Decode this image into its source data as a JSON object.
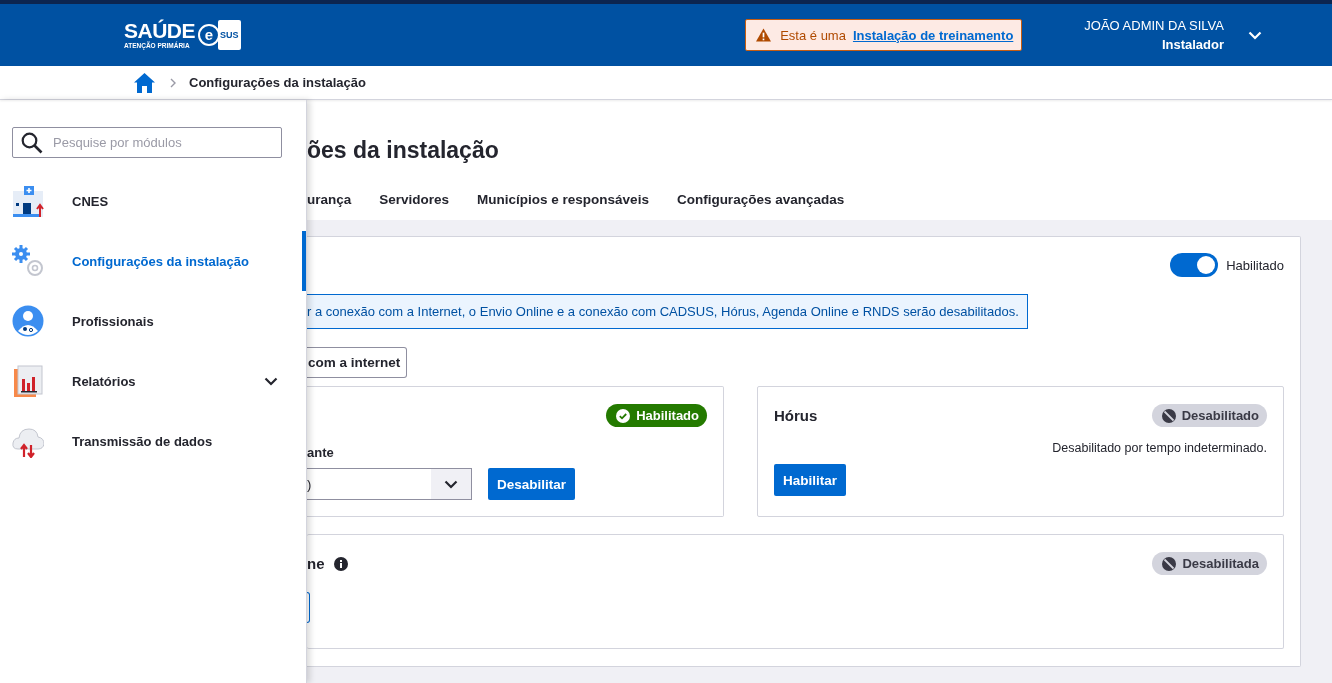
{
  "header": {
    "logo": {
      "title": "SAÚDE",
      "subtitle": "ATENÇÃO PRIMÁRIA",
      "mark": "e",
      "mark_text": "SUS"
    },
    "training_notice": {
      "prefix": "Esta é uma",
      "link": "Instalação de treinamento"
    },
    "user": {
      "name": "JOÃO ADMIN DA SILVA",
      "role": "Instalador"
    }
  },
  "breadcrumb": {
    "current": "Configurações da instalação"
  },
  "drawer": {
    "search": {
      "placeholder": "Pesquise por módulos"
    },
    "items": [
      {
        "label": "CNES",
        "kind": "building",
        "selected": false,
        "has_submenu": false
      },
      {
        "label": "Configurações da instalação",
        "kind": "gears",
        "selected": true,
        "has_submenu": false
      },
      {
        "label": "Profissionais",
        "kind": "person",
        "selected": false,
        "has_submenu": false
      },
      {
        "label": "Relatórios",
        "kind": "report",
        "selected": false,
        "has_submenu": true
      },
      {
        "label": "Transmissão de dados",
        "kind": "cloud",
        "selected": false,
        "has_submenu": false
      }
    ]
  },
  "page": {
    "title": "ões da instalação",
    "tabs": [
      {
        "label": "urança",
        "selected": false
      },
      {
        "label": "Servidores",
        "selected": false
      },
      {
        "label": "Municípios e responsáveis",
        "selected": false
      },
      {
        "label": "Configurações avançadas",
        "selected": false
      }
    ],
    "internet_card": {
      "toggle": {
        "on": true,
        "label": "Habilitado"
      },
      "info": "r a conexão com a Internet, o Envio Online e a conexão com CADSUS, Hórus, Agenda Online e RNDS serão desabilitados.",
      "button": "com a internet",
      "services": [
        {
          "status": {
            "label": "Habilitado",
            "enabled": true
          },
          "field_label": "ante",
          "select_value": ")",
          "button": "Desabilitar"
        },
        {
          "title": "Hórus",
          "status": {
            "label": "Desabilitado",
            "enabled": false
          },
          "note": "Desabilitado por tempo indeterminado.",
          "button": "Habilitar"
        },
        {
          "title": "ne",
          "info_icon": true,
          "status": {
            "label": "Desabilitada",
            "enabled": false
          },
          "button_edge": true
        }
      ]
    }
  }
}
